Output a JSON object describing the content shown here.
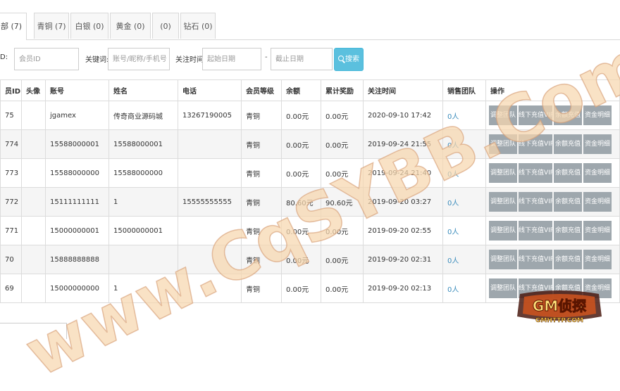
{
  "tabs": [
    {
      "label": "部 (7)",
      "active": true
    },
    {
      "label": "青铜 (7)"
    },
    {
      "label": "白银 (0)"
    },
    {
      "label": "黄金 (0)"
    },
    {
      "label": "(0)"
    },
    {
      "label": "钻石 (0)"
    }
  ],
  "filters": {
    "id_label": "D:",
    "id_placeholder": "会员ID",
    "keyword_label": "关键词:",
    "keyword_placeholder": "账号/昵称/手机号",
    "time_label": "关注时间:",
    "start_placeholder": "起始日期",
    "separator": "-",
    "end_placeholder": "截止日期",
    "search_label": "搜索"
  },
  "table": {
    "headers": [
      "员ID",
      "头像",
      "账号",
      "姓名",
      "电话",
      "会员等级",
      "余额",
      "累计奖励",
      "关注时间",
      "销售团队",
      "操作"
    ],
    "rows": [
      {
        "id": "75",
        "account": "jgamex",
        "name": "传奇商业源码城",
        "phone": "13267190005",
        "level": "青铜",
        "balance": "0.00元",
        "reward": "0.00元",
        "time": "2020-09-10 17:42",
        "team": "0人"
      },
      {
        "id": "774",
        "account": "15588000001",
        "name": "15588000001",
        "phone": "",
        "level": "青铜",
        "balance": "0.00元",
        "reward": "0.00元",
        "time": "2019-09-24 21:55",
        "team": "0人"
      },
      {
        "id": "773",
        "account": "15588000000",
        "name": "15588000000",
        "phone": "",
        "level": "青铜",
        "balance": "0.00元",
        "reward": "0.00元",
        "time": "2019-09-24 21:40",
        "team": "0人"
      },
      {
        "id": "772",
        "account": "15111111111",
        "name": "1",
        "phone": "15555555555",
        "level": "青铜",
        "balance": "80.60元",
        "reward": "90.60元",
        "time": "2019-09-20 03:27",
        "team": "0人"
      },
      {
        "id": "771",
        "account": "15000000001",
        "name": "15000000001",
        "phone": "",
        "level": "青铜",
        "balance": "0.00元",
        "reward": "0.00元",
        "time": "2019-09-20 02:55",
        "team": "0人"
      },
      {
        "id": "70",
        "account": "15888888888",
        "name": "",
        "phone": "",
        "level": "青铜",
        "balance": "0.00元",
        "reward": "0.00元",
        "time": "2019-09-20 02:31",
        "team": "0人"
      },
      {
        "id": "69",
        "account": "15000000000",
        "name": "1",
        "phone": "",
        "level": "青铜",
        "balance": "0.00元",
        "reward": "0.00元",
        "time": "2019-09-20 02:13",
        "team": "0人"
      }
    ],
    "ops": [
      "调整团队",
      "线下充值VIP",
      "余额充值",
      "资金明细"
    ]
  },
  "watermark": {
    "text": "www.CqSYBB.Com",
    "logo_main": "GM侦探",
    "logo_sub": "GMHTTP.COM"
  }
}
